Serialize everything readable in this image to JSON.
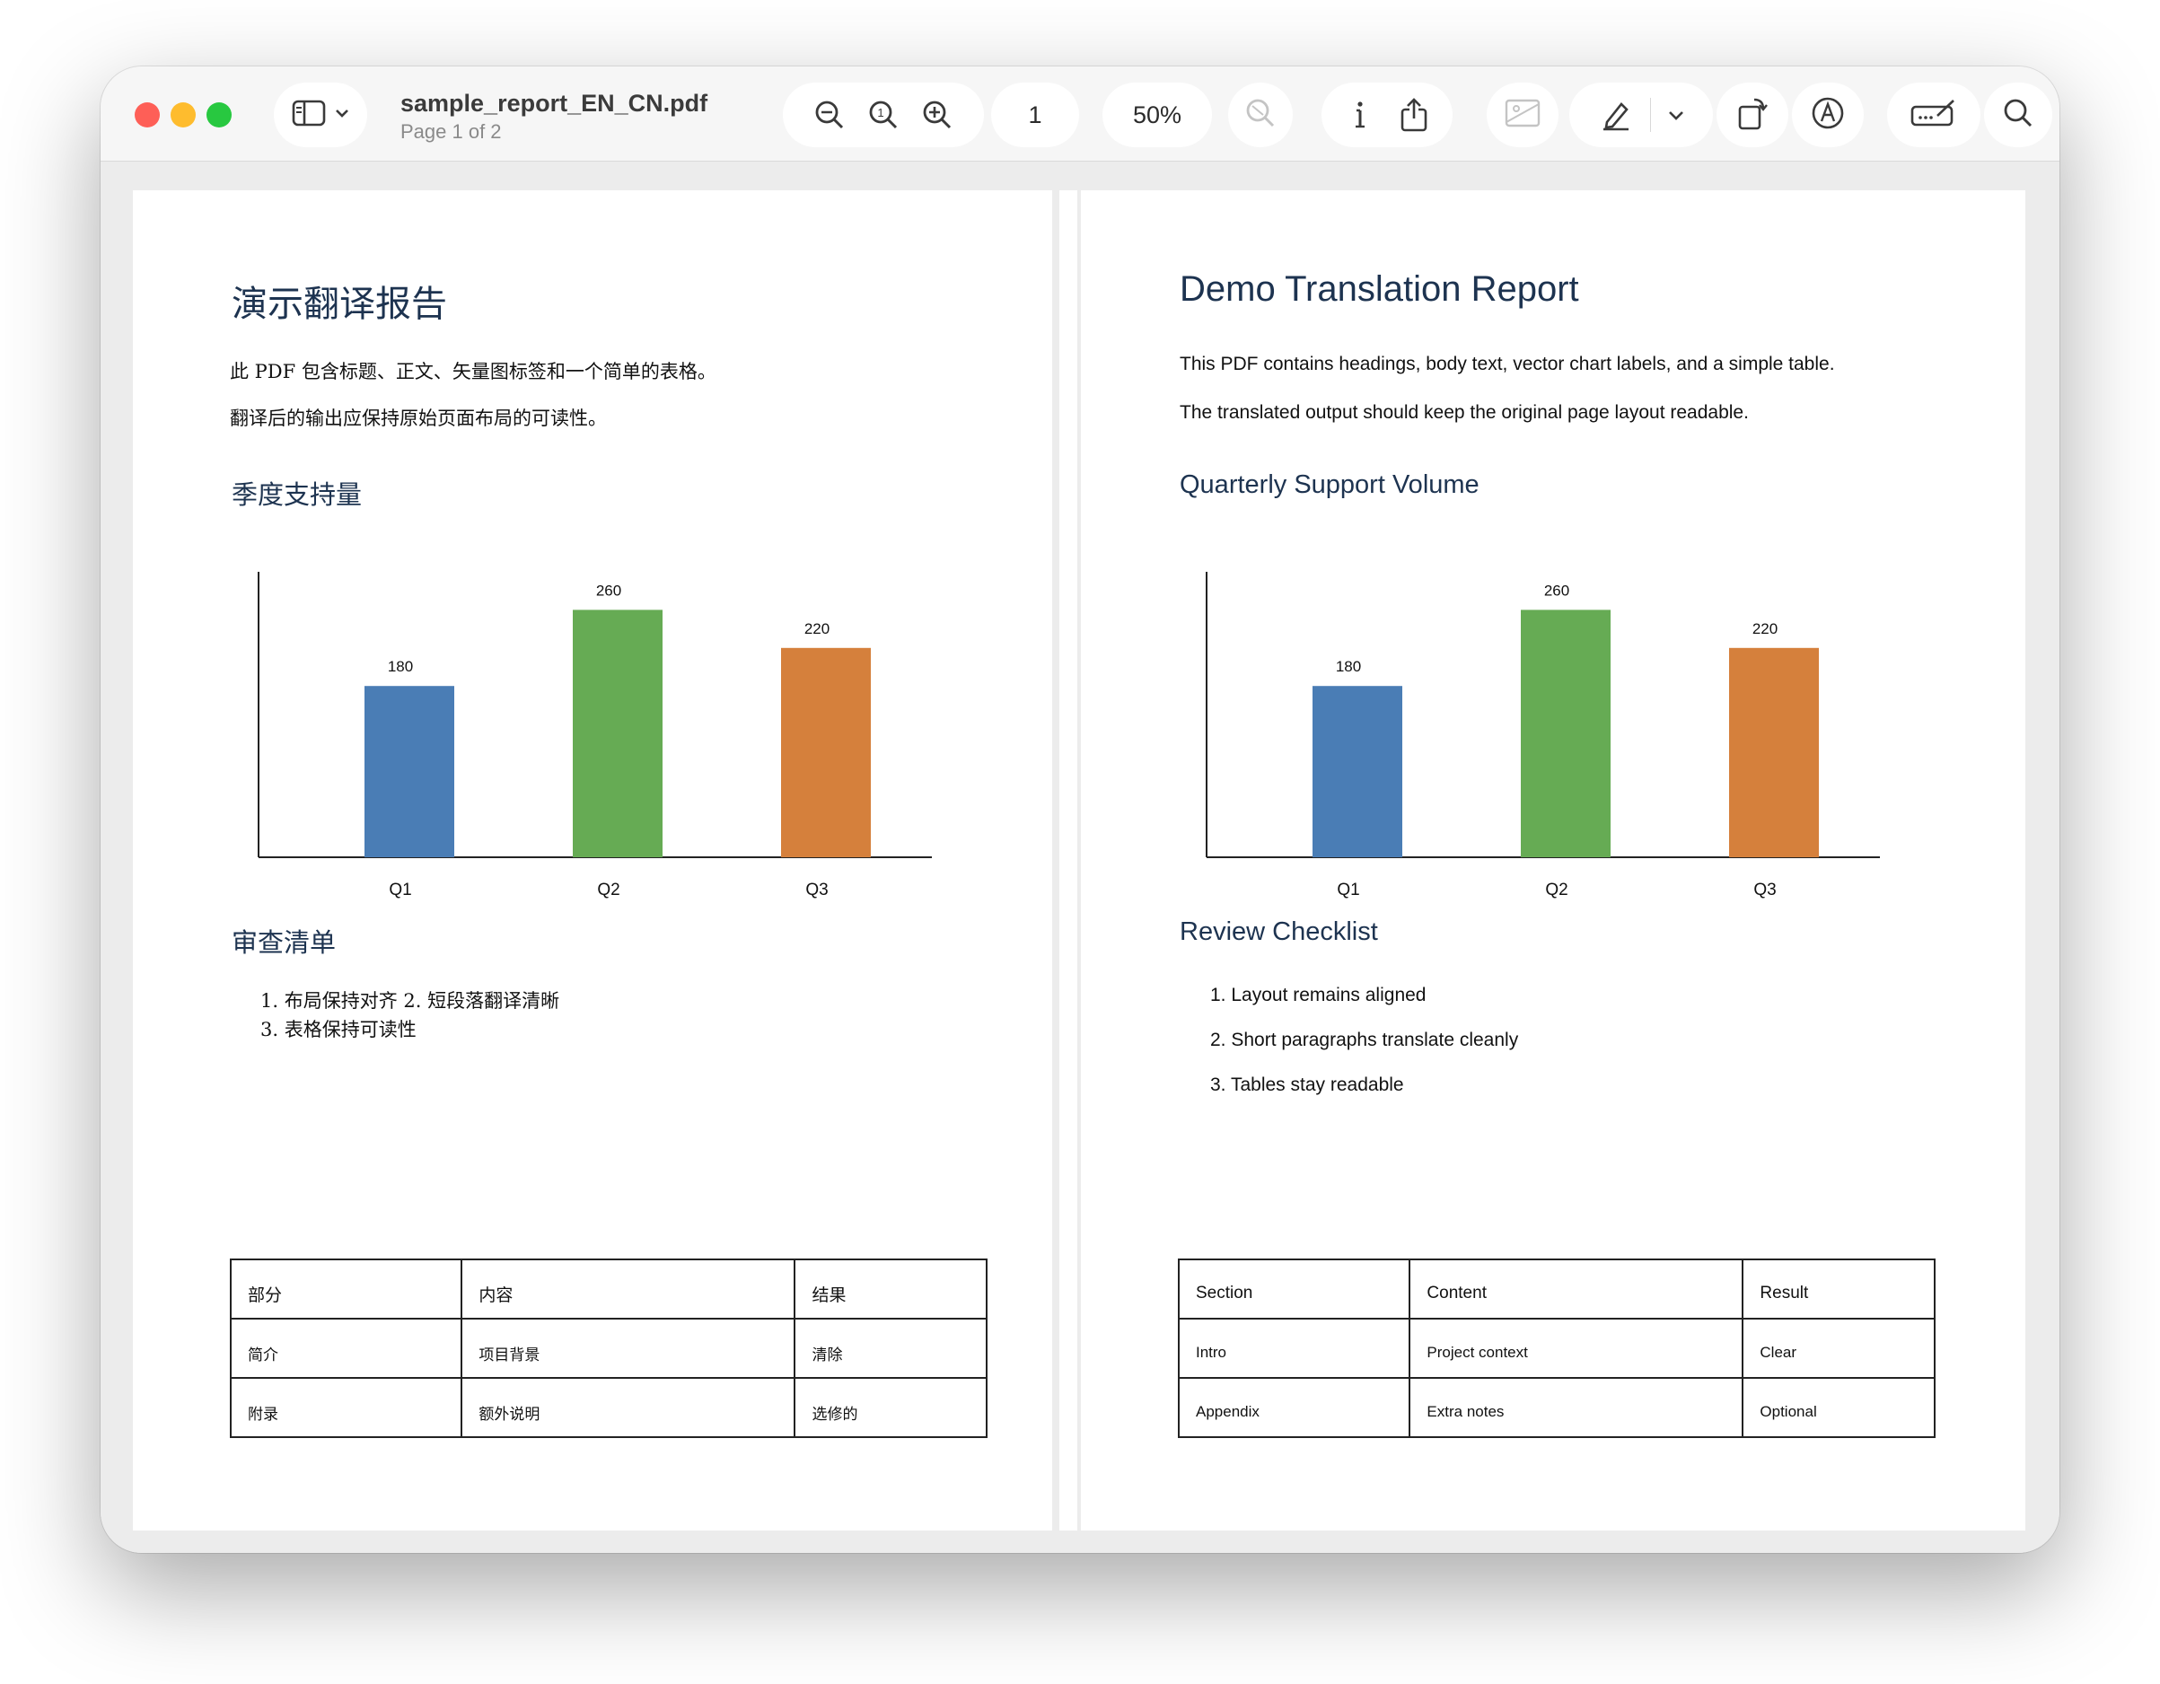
{
  "window": {
    "filename": "sample_report_EN_CN.pdf",
    "page_indicator": "Page 1 of 2",
    "page_number": "1",
    "zoom": "50%",
    "traffic_lights": {
      "close": "#fe5f57",
      "minimize": "#febc2e",
      "zoom": "#28c840"
    },
    "toolbar_icons": [
      "sidebar-icon",
      "chevron-down-icon",
      "zoom-out-icon",
      "actual-size-icon",
      "zoom-in-icon",
      "search-disabled-icon",
      "info-icon",
      "share-icon",
      "image-disabled-icon",
      "highlight-pen-icon",
      "chevron-down-icon",
      "rotate-icon",
      "markup-icon",
      "signature-icon",
      "search-icon"
    ]
  },
  "pages": {
    "cn": {
      "title": "演示翻译报告",
      "para1": "此 PDF 包含标题、正文、矢量图标签和一个简单的表格。",
      "para2": "翻译后的输出应保持原始页面布局的可读性。",
      "chart_heading": "季度支持量",
      "checklist_heading": "审查清单",
      "checklist_line1": "1. 布局保持对齐 2. 短段落翻译清晰",
      "checklist_line2": "3. 表格保持可读性",
      "table": [
        [
          "部分",
          "内容",
          "结果"
        ],
        [
          "简介",
          "项目背景",
          "清除"
        ],
        [
          "附录",
          "额外说明",
          "选修的"
        ]
      ]
    },
    "en": {
      "title": "Demo Translation Report",
      "para1": "This PDF contains headings, body text, vector chart labels, and a simple table.",
      "para2": "The translated output should keep the original page layout readable.",
      "chart_heading": "Quarterly Support Volume",
      "checklist_heading": "Review Checklist",
      "checklist": [
        "1. Layout remains aligned",
        "2. Short paragraphs translate cleanly",
        "3. Tables stay readable"
      ],
      "table": [
        [
          "Section",
          "Content",
          "Result"
        ],
        [
          "Intro",
          "Project context",
          "Clear"
        ],
        [
          "Appendix",
          "Extra notes",
          "Optional"
        ]
      ]
    }
  },
  "chart_data": [
    {
      "type": "bar",
      "categories": [
        "Q1",
        "Q2",
        "Q3"
      ],
      "values": [
        180,
        260,
        220
      ],
      "colors": [
        "#4a7db5",
        "#66ab54",
        "#d5803c"
      ],
      "ylim": [
        0,
        300
      ],
      "grid": false,
      "data_labels": true
    },
    {
      "type": "bar",
      "categories": [
        "Q1",
        "Q2",
        "Q3"
      ],
      "values": [
        180,
        260,
        220
      ],
      "colors": [
        "#4a7db5",
        "#66ab54",
        "#d5803c"
      ],
      "ylim": [
        0,
        300
      ],
      "grid": false,
      "data_labels": true
    }
  ]
}
